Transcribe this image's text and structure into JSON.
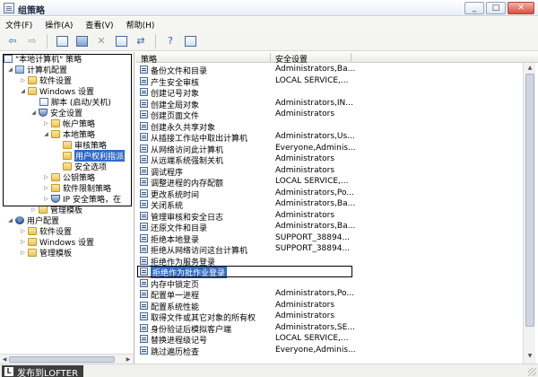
{
  "window": {
    "title": "组策略"
  },
  "menu": {
    "items": [
      "文件(F)",
      "操作(A)",
      "查看(V)",
      "帮助(H)"
    ]
  },
  "toolbar": {
    "icons": [
      "back-arrow-icon",
      "forward-arrow-icon",
      "up-folder-icon",
      "show-tree-icon",
      "delete-icon",
      "properties-icon",
      "refresh-icon",
      "help-icon",
      "extend-view-icon"
    ]
  },
  "tree": {
    "root": "\"本地计算机\" 策略",
    "computer_config": "计算机配置",
    "software_settings": "软件设置",
    "windows_settings": "Windows 设置",
    "scripts": "脚本 (启动/关机)",
    "security_settings": "安全设置",
    "account_policies": "帐户策略",
    "local_policies": "本地策略",
    "audit_policy": "审核策略",
    "user_rights": "用户权利指派",
    "security_options": "安全选项",
    "public_key": "公钥策略",
    "software_restriction": "软件限制策略",
    "ip_security": "IP 安全策略，在",
    "admin_templates": "管理模板",
    "user_config": "用户配置",
    "user_software": "软件设置",
    "user_windows": "Windows 设置",
    "user_admin_templates": "管理模板"
  },
  "list": {
    "columns": {
      "policy": "策略",
      "setting": "安全设置"
    },
    "selected_index": 18,
    "rows": [
      {
        "policy": "备份文件和目录",
        "setting": "Administrators,Ba..."
      },
      {
        "policy": "产生安全审核",
        "setting": "LOCAL SERVICE,..."
      },
      {
        "policy": "创建记号对象",
        "setting": ""
      },
      {
        "policy": "创建全局对象",
        "setting": "Administrators,IN..."
      },
      {
        "policy": "创建页面文件",
        "setting": "Administrators"
      },
      {
        "policy": "创建永久共享对象",
        "setting": ""
      },
      {
        "policy": "从插接工作站中取出计算机",
        "setting": "Administrators,Us..."
      },
      {
        "policy": "从网络访问此计算机",
        "setting": "Everyone,Adminis..."
      },
      {
        "policy": "从远端系统强制关机",
        "setting": "Administrators"
      },
      {
        "policy": "调试程序",
        "setting": "Administrators"
      },
      {
        "policy": "调整进程的内存配额",
        "setting": "LOCAL SERVICE,..."
      },
      {
        "policy": "更改系统时间",
        "setting": "Administrators,Po..."
      },
      {
        "policy": "关闭系统",
        "setting": "Administrators,Ba..."
      },
      {
        "policy": "管理审核和安全日志",
        "setting": "Administrators"
      },
      {
        "policy": "还原文件和目录",
        "setting": "Administrators,Ba..."
      },
      {
        "policy": "拒绝本地登录",
        "setting": "SUPPORT_38894..."
      },
      {
        "policy": "拒绝从网络访问这台计算机",
        "setting": "SUPPORT_38894..."
      },
      {
        "policy": "拒绝作为服务登录",
        "setting": ""
      },
      {
        "policy": "拒绝作为批作业登录",
        "setting": ""
      },
      {
        "policy": "内存中锁定页",
        "setting": ""
      },
      {
        "policy": "配置单一进程",
        "setting": "Administrators,Po..."
      },
      {
        "policy": "配置系统性能",
        "setting": "Administrators"
      },
      {
        "policy": "取得文件或其它对象的所有权",
        "setting": "Administrators"
      },
      {
        "policy": "身份验证后模拟客户端",
        "setting": "Administrators,SE..."
      },
      {
        "policy": "替换进程级记号",
        "setting": "LOCAL SERVICE,..."
      },
      {
        "policy": "跳过遍历检查",
        "setting": "Everyone,Adminis..."
      }
    ]
  },
  "watermark": {
    "logo": "L",
    "text": "发布到LOFTER"
  }
}
